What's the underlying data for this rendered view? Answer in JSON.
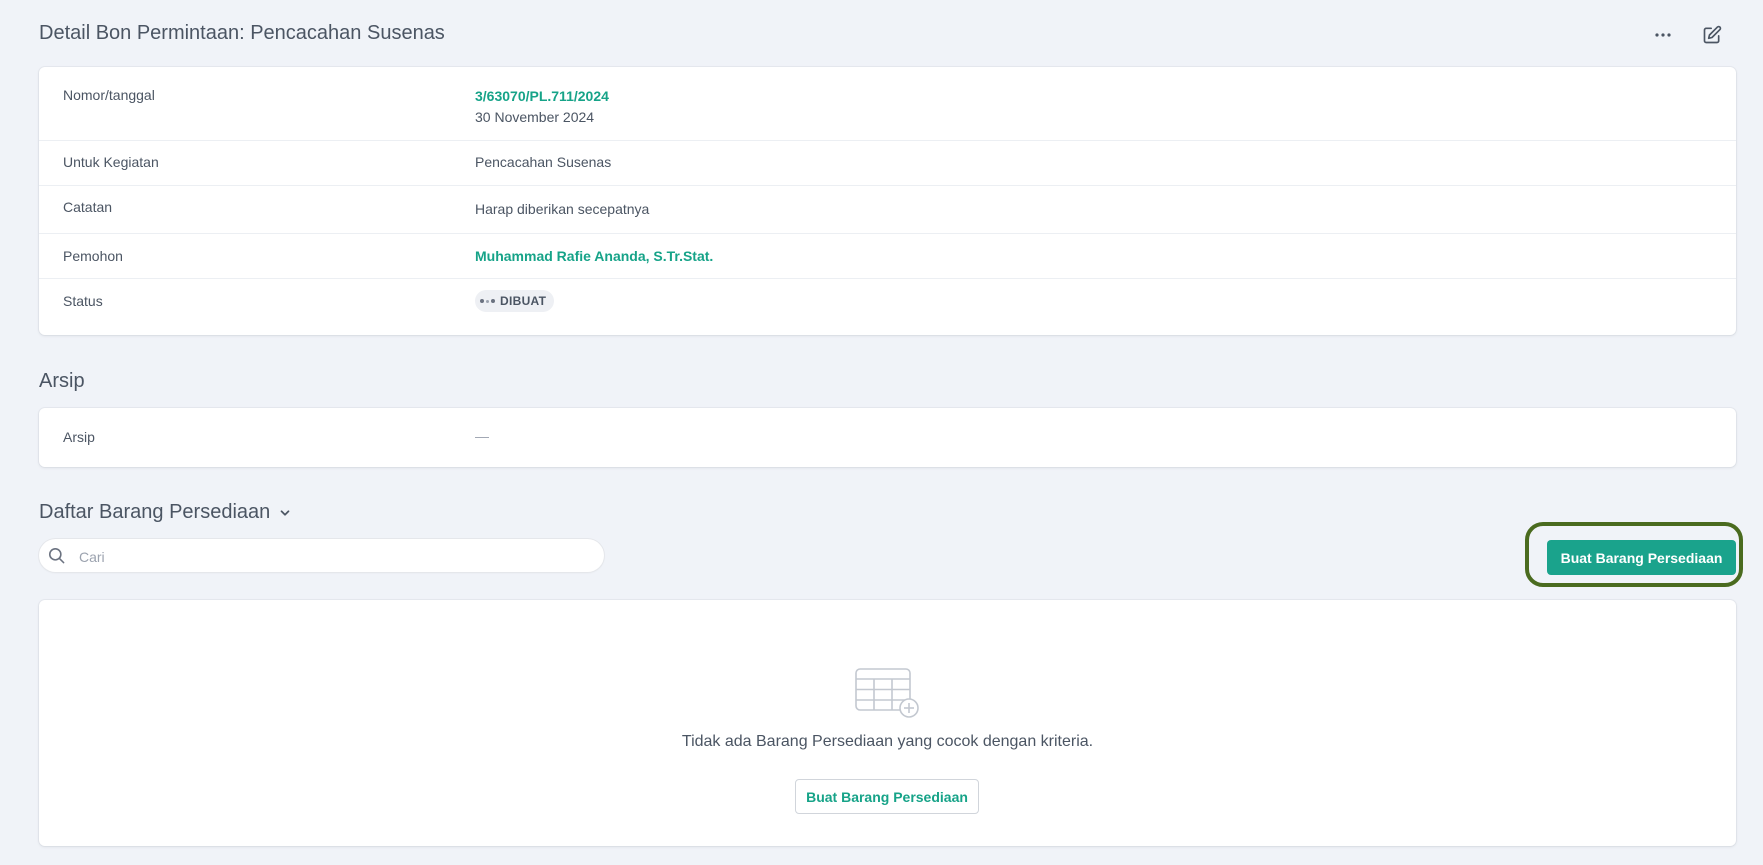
{
  "header": {
    "title": "Detail Bon Permintaan: Pencacahan Susenas"
  },
  "detail": {
    "rows": [
      {
        "label": "Nomor/tanggal",
        "value": "3/63070/PL.711/2024",
        "value2": "30 November 2024"
      },
      {
        "label": "Untuk Kegiatan",
        "value": "Pencacahan Susenas"
      },
      {
        "label": "Catatan",
        "value": "Harap diberikan secepatnya"
      },
      {
        "label": "Pemohon",
        "value": "Muhammad Rafie Ananda, S.Tr.Stat."
      },
      {
        "label": "Status",
        "value": "DIBUAT"
      }
    ]
  },
  "arsip": {
    "title": "Arsip",
    "label": "Arsip",
    "value": "—"
  },
  "daftar": {
    "title": "Daftar Barang Persediaan",
    "search_placeholder": "Cari",
    "create_button": "Buat Barang Persediaan",
    "empty_text": "Tidak ada Barang Persediaan yang cocok dengan kriteria.",
    "empty_button": "Buat Barang Persediaan"
  },
  "colors": {
    "accent": "#1aa38c",
    "highlight": "#4a6b1f",
    "background": "#f0f3f8"
  }
}
